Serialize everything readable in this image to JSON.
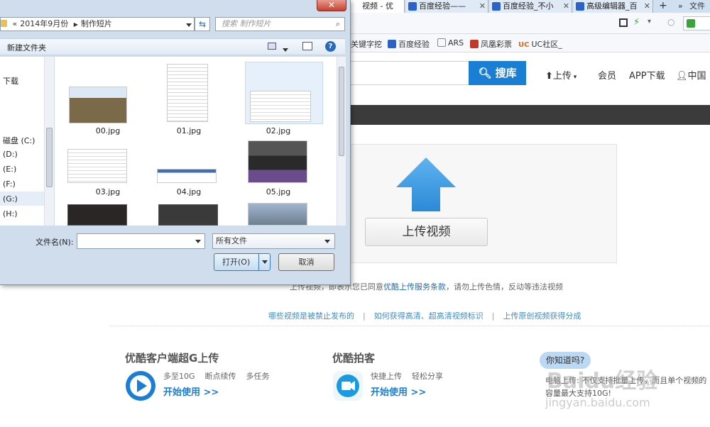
{
  "browser": {
    "tabs": [
      {
        "label": "视频 - 优"
      },
      {
        "label": "百度经验——"
      },
      {
        "label": "百度经验_不小"
      },
      {
        "label": "高级编辑器_百"
      }
    ],
    "new_tab": "+",
    "more": "»",
    "tab_menu": "文件",
    "bookmarks": [
      {
        "label": "关键字挖",
        "color": "#6a6a6a"
      },
      {
        "label": "百度经验",
        "color": "#2a62c9"
      },
      {
        "label": "ARS",
        "color": "#888888"
      },
      {
        "label": "凤凰彩票",
        "color": "#c0392b"
      },
      {
        "label": "UC社区_",
        "color": "#e06a1b"
      }
    ]
  },
  "page": {
    "search_button": "搜库",
    "nav": [
      "上传",
      "会员",
      "APP下载",
      "中国"
    ],
    "upload_button": "上传视频",
    "terms": {
      "prefix": "上传视频，即表示您已同意",
      "link": "优酷上传服务条款",
      "suffix": "，请勿上传色情，反动等违法视频"
    },
    "help_links": [
      "哪些视频是被禁止发布的",
      "如何获得高清、超高清视频标识",
      "上传原创视频获得分成"
    ],
    "client": {
      "title": "优酷客户端超G上传",
      "features": [
        "多至10G",
        "断点续传",
        "多任务"
      ],
      "cta": "开始使用 >>"
    },
    "paike": {
      "title": "优酷拍客",
      "features": [
        "快捷上传",
        "轻松分享"
      ],
      "cta": "开始使用 >>"
    },
    "did_you_know": {
      "badge": "你知道吗?",
      "text": "电脑上传: 不仅支持批量上传，而且单个视频的容量最大支持10G!"
    },
    "watermark": "Baidu经验",
    "watermark_url": "jingyan.baidu.com"
  },
  "dialog": {
    "breadcrumb": [
      "2014年9月份",
      "制作短片"
    ],
    "search_placeholder": "搜索 制作短片",
    "new_folder": "新建文件夹",
    "nav_items": [
      "下载",
      "磁盘 (C:)",
      "(D:)",
      "(E:)",
      "(F:)",
      "(G:)",
      "(H:)"
    ],
    "files": [
      "00.jpg",
      "01.jpg",
      "02.jpg",
      "03.jpg",
      "04.jpg",
      "05.jpg"
    ],
    "filename_label": "文件名(N):",
    "filename_value": "",
    "filetype": "所有文件",
    "open_button": "打开(O)",
    "cancel_button": "取消",
    "close": "✕"
  }
}
